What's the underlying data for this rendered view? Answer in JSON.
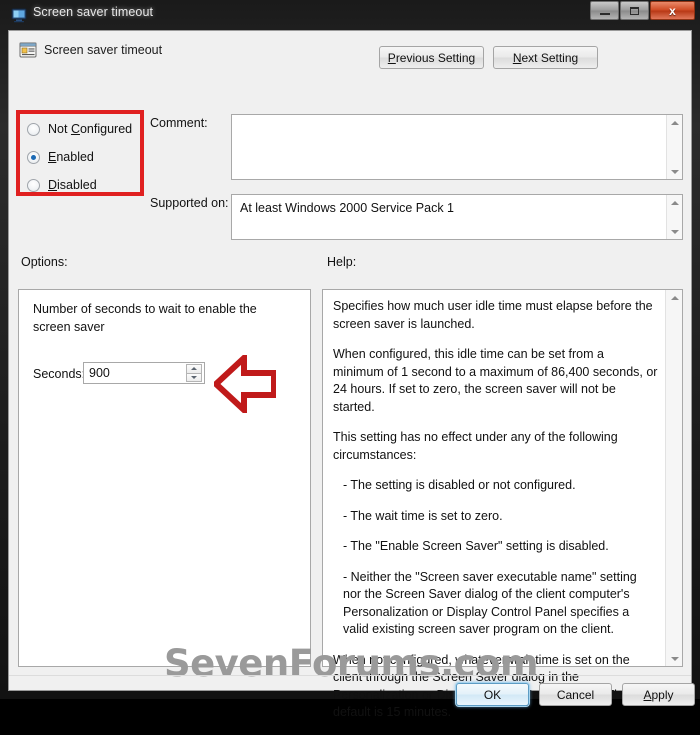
{
  "window": {
    "title": "Screen saver timeout",
    "icon": "monitor-icon",
    "caption_buttons": {
      "minimize": "minimize-icon",
      "maximize": "maximize-icon",
      "close": "x"
    }
  },
  "header": {
    "icon": "policy-setting-icon",
    "title": "Screen saver timeout",
    "previous_setting": {
      "pre": "",
      "key": "P",
      "post": "revious Setting"
    },
    "next_setting": {
      "pre": "",
      "key": "N",
      "post": "ext Setting"
    }
  },
  "state_options": {
    "items": [
      {
        "label_pre": "Not ",
        "key": "C",
        "label_post": "onfigured",
        "selected": false,
        "name": "not-configured"
      },
      {
        "label_pre": "",
        "key": "E",
        "label_post": "nabled",
        "selected": true,
        "name": "enabled"
      },
      {
        "label_pre": "",
        "key": "D",
        "label_post": "isabled",
        "selected": false,
        "name": "disabled"
      }
    ],
    "annotation_color": "#e02020"
  },
  "comment": {
    "label": "Comment:",
    "value": ""
  },
  "supported_on": {
    "label": "Supported on:",
    "value": "At least Windows 2000 Service Pack 1"
  },
  "options": {
    "header": "Options:",
    "description": "Number of seconds to wait to enable the screen saver",
    "seconds_label": "Seconds:",
    "seconds_value": "900",
    "arrow_annotation_color": "#c01a1a"
  },
  "help": {
    "header": "Help:",
    "paragraphs": [
      {
        "text": "Specifies how much user idle time must elapse before the screen saver is launched.",
        "bullet": false
      },
      {
        "text": "When configured, this idle time can be set from a minimum of 1 second to a maximum of 86,400 seconds, or 24 hours. If set to zero, the screen saver will not be started.",
        "bullet": false
      },
      {
        "text": "This setting has no effect under any of the following circumstances:",
        "bullet": false
      },
      {
        "text": "- The setting is disabled or not configured.",
        "bullet": true
      },
      {
        "text": "- The wait time is set to zero.",
        "bullet": true
      },
      {
        "text": "- The \"Enable Screen Saver\" setting is disabled.",
        "bullet": true
      },
      {
        "text": "- Neither the \"Screen saver executable name\" setting nor the Screen Saver dialog of the client computer's Personalization or Display Control Panel specifies a valid existing screen saver program on the client.",
        "bullet": true
      },
      {
        "text": "When not configured, whatever wait time is set on the client through the Screen Saver dialog in the Personalization or Display Control Panel is used. The default is 15 minutes.",
        "bullet": false
      }
    ]
  },
  "watermark": {
    "text": "SevenForums.com",
    "color": "#9a9a9a"
  },
  "footer": {
    "ok": "OK",
    "cancel": "Cancel",
    "apply": {
      "pre": "",
      "key": "A",
      "post": "pply"
    }
  }
}
